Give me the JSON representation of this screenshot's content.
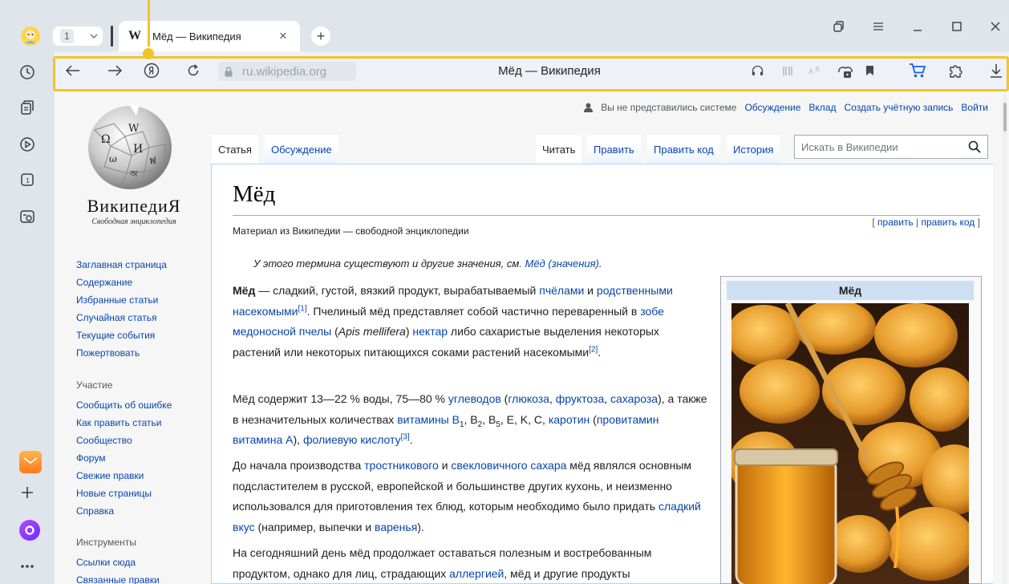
{
  "browser": {
    "tab_count": "1",
    "tab": {
      "favicon": "W",
      "title": "Мёд — Википедия",
      "close": "×"
    },
    "new_tab": "+",
    "url": "ru.wikipedia.org",
    "page_title": "Мёд — Википедия"
  },
  "wiki": {
    "user_bar": {
      "not_logged_in": "Вы не представились системе",
      "links": [
        "Обсуждение",
        "Вклад",
        "Создать учётную запись",
        "Войти"
      ]
    },
    "logo": {
      "wordmark": "ВикипедиЯ",
      "tagline": "Свободная энциклопедия"
    },
    "nav_main": [
      "Заглавная страница",
      "Содержание",
      "Избранные статьи",
      "Случайная статья",
      "Текущие события",
      "Пожертвовать"
    ],
    "nav_participation_head": "Участие",
    "nav_participation": [
      "Сообщить об ошибке",
      "Как править статьи",
      "Сообщество",
      "Форум",
      "Свежие правки",
      "Новые страницы",
      "Справка"
    ],
    "nav_tools_head": "Инструменты",
    "nav_tools": [
      "Ссылки сюда",
      "Связанные правки"
    ],
    "tabs_left": [
      "Статья",
      "Обсуждение"
    ],
    "tabs_right": [
      "Читать",
      "Править",
      "Править код",
      "История"
    ],
    "search_placeholder": "Искать в Википедии",
    "title": "Мёд",
    "edit_links": {
      "open": "[",
      "edit": "править",
      "sep": "|",
      "edit_code": "править код",
      "close": "]"
    },
    "subtitle": "Материал из Википедии — свободной энциклопедии",
    "hatnote": {
      "text": "У этого термина существуют и другие значения, см. ",
      "link": "Мёд (значения)",
      "end": "."
    },
    "p1": {
      "bold": "Мёд",
      "t1": " — сладкий, густой, вязкий продукт, вырабатываемый ",
      "l1": "пчёлами",
      "t2": " и ",
      "l2": "родственными насекомыми",
      "r1": "[1]",
      "t3": ". Пчелиный мёд представляет собой частично переваренный в ",
      "l3": "зобе медоносной пчелы",
      "t4": " (",
      "latin": "Apis mellifera",
      "t5": ") ",
      "l4": "нектар",
      "t6": " либо сахаристые выделения некоторых растений или некоторых питающихся соками растений насекомыми",
      "r2": "[2]",
      "t7": "."
    },
    "p2": {
      "t1": "Мёд содержит 13—22 % воды, 75—80 % ",
      "l1": "углеводов",
      "t2": " (",
      "l2": "глюкоза",
      "t3": ", ",
      "l3": "фруктоза",
      "t4": ", ",
      "l4": "сахароза",
      "t5": "), а также в незначительных количествах ",
      "l5": "витамины B",
      "s1": "1",
      "t6": ", B",
      "s2": "2",
      "t7": ", B",
      "s3": "5",
      "t8": ", E, K, C, ",
      "l6": "каротин",
      "t9": " (",
      "l7": "провитамин витамина А",
      "t10": "), ",
      "l8": "фолиевую кислоту",
      "r3": "[3]",
      "t11": "."
    },
    "p3": {
      "t1": "До начала производства ",
      "l1": "тростникового",
      "t2": " и ",
      "l2": "свекловичного сахара",
      "t3": " мёд являлся основным подсластителем в русской, европейской и большинстве других кухонь, и неизменно использовался для приготовления тех блюд, которым необходимо было придать ",
      "l3": "сладкий вкус",
      "t4": " (например, выпечки и ",
      "l4": "варенья",
      "t5": ")."
    },
    "p4": {
      "t1": "На сегодняшний день мёд продолжает оставаться полезным и востребованным продуктом, однако для лиц, страдающих ",
      "l1": "аллергией",
      "t2": ", мёд и другие продукты"
    },
    "infobox_title": "Мёд"
  },
  "colors": {
    "accent": "#f2c42b",
    "link": "#0645ad",
    "chrome": "#dfe5eb"
  }
}
